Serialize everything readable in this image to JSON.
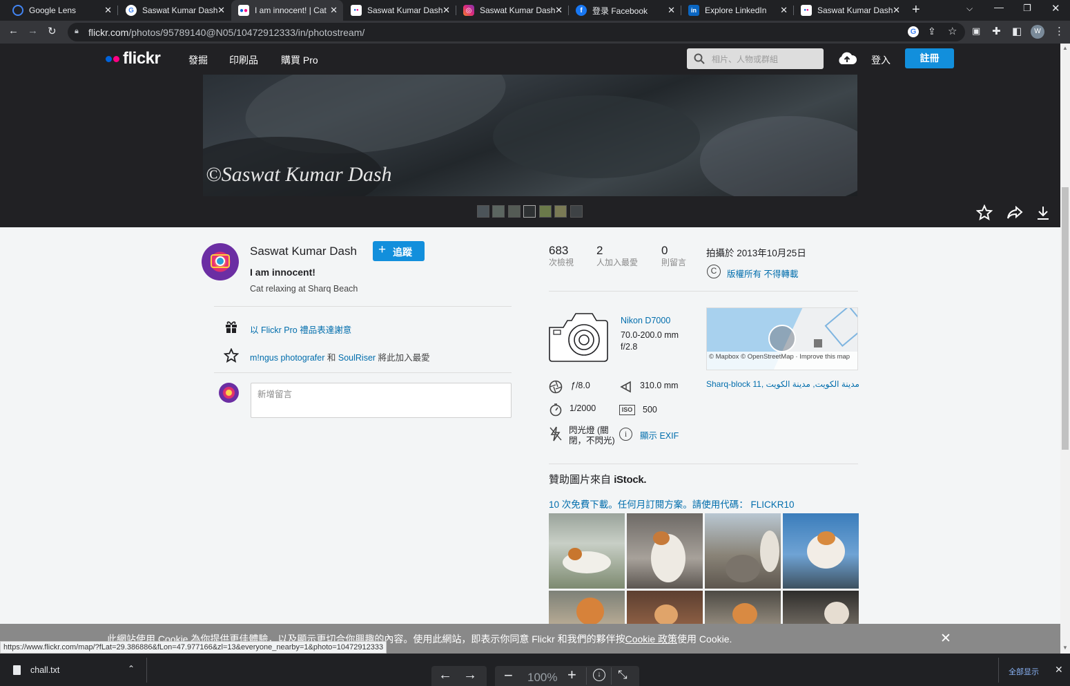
{
  "browser": {
    "tabs": [
      {
        "title": "Google Lens",
        "favicon": "google-lens-icon",
        "color": "#4285f4"
      },
      {
        "title": "Saswat Kumar Dash",
        "favicon": "google-icon",
        "color": "#ffffff"
      },
      {
        "title": "I am innocent! | Cat",
        "favicon": "flickr-icon",
        "color": "#ff0084",
        "active": true
      },
      {
        "title": "Saswat Kumar Dash",
        "favicon": "flickr-icon",
        "color": "#ff0084"
      },
      {
        "title": "Saswat Kumar Dash",
        "favicon": "instagram-icon",
        "color": "#e1306c"
      },
      {
        "title": "登录 Facebook",
        "favicon": "facebook-icon",
        "color": "#1877f2"
      },
      {
        "title": "Explore LinkedIn",
        "favicon": "linkedin-icon",
        "color": "#0a66c2"
      },
      {
        "title": "Saswat Kumar Dash",
        "favicon": "flickr-icon",
        "color": "#ff0084"
      }
    ],
    "url_host": "flickr.com",
    "url_path": "/photos/95789140@N05/10472912333/in/photostream/",
    "profile_initial": "W"
  },
  "flickr": {
    "logo": "flickr",
    "nav": [
      "發掘",
      "印刷品",
      "購買 Pro"
    ],
    "search_placeholder": "相片、人物或群組",
    "login": "登入",
    "signup": "註冊"
  },
  "photo": {
    "watermark": "©Saswat Kumar Dash"
  },
  "owner": {
    "name": "Saswat Kumar Dash",
    "follow_label": "追蹤",
    "title": "I am innocent!",
    "description": "Cat relaxing at Sharq Beach"
  },
  "gift": {
    "text": "以 Flickr Pro 禮品表達謝意"
  },
  "faves": {
    "user1": "m!ngus photografer",
    "and": "和",
    "user2": "SoulRiser",
    "suffix": "將此加入最愛"
  },
  "comment": {
    "placeholder": "新增留言"
  },
  "stats": {
    "views": "683",
    "views_label": "次檢視",
    "faves": "2",
    "faves_label": "人加入最愛",
    "comments": "0",
    "comments_label": "則留言",
    "taken": "拍攝於 2013年10月25日",
    "license": "版權所有 不得轉載"
  },
  "camera": {
    "model": "Nikon D7000",
    "lens": "70.0-200.0 mm",
    "aperture_max": "f/2.8",
    "fstop": "ƒ/8.0",
    "focal": "310.0 mm",
    "shutter": "1/2000",
    "iso_badge": "ISO",
    "iso": "500",
    "flash": "閃光燈 (關閉，不閃光)",
    "exif": "顯示 EXIF"
  },
  "map": {
    "credit": "© Mapbox © OpenStreetMap · Improve this map",
    "location": "Sharq-block 11, مدينة الكويت, مدينة الكويت"
  },
  "istock": {
    "heading": "贊助圖片來自",
    "brand": "iStock.",
    "promo": "10 次免費下載。任何月訂閱方案。請使用代碼： FLICKR10"
  },
  "cookie": {
    "text": "此網站使用 Cookie 為你提供更佳體驗，以及顯示更切合你興趣的內容。使用此網站，即表示你同意 Flickr 和我們的夥伴按",
    "link": "Cookie 政策",
    "suffix": "使用 Cookie."
  },
  "status_url": "https://www.flickr.com/map/?fLat=29.386886&fLon=47.977166&zl=13&everyone_nearby=1&photo=10472912333",
  "download": {
    "file": "chall.txt",
    "zoom": "100%",
    "show_all": "全部显示"
  }
}
